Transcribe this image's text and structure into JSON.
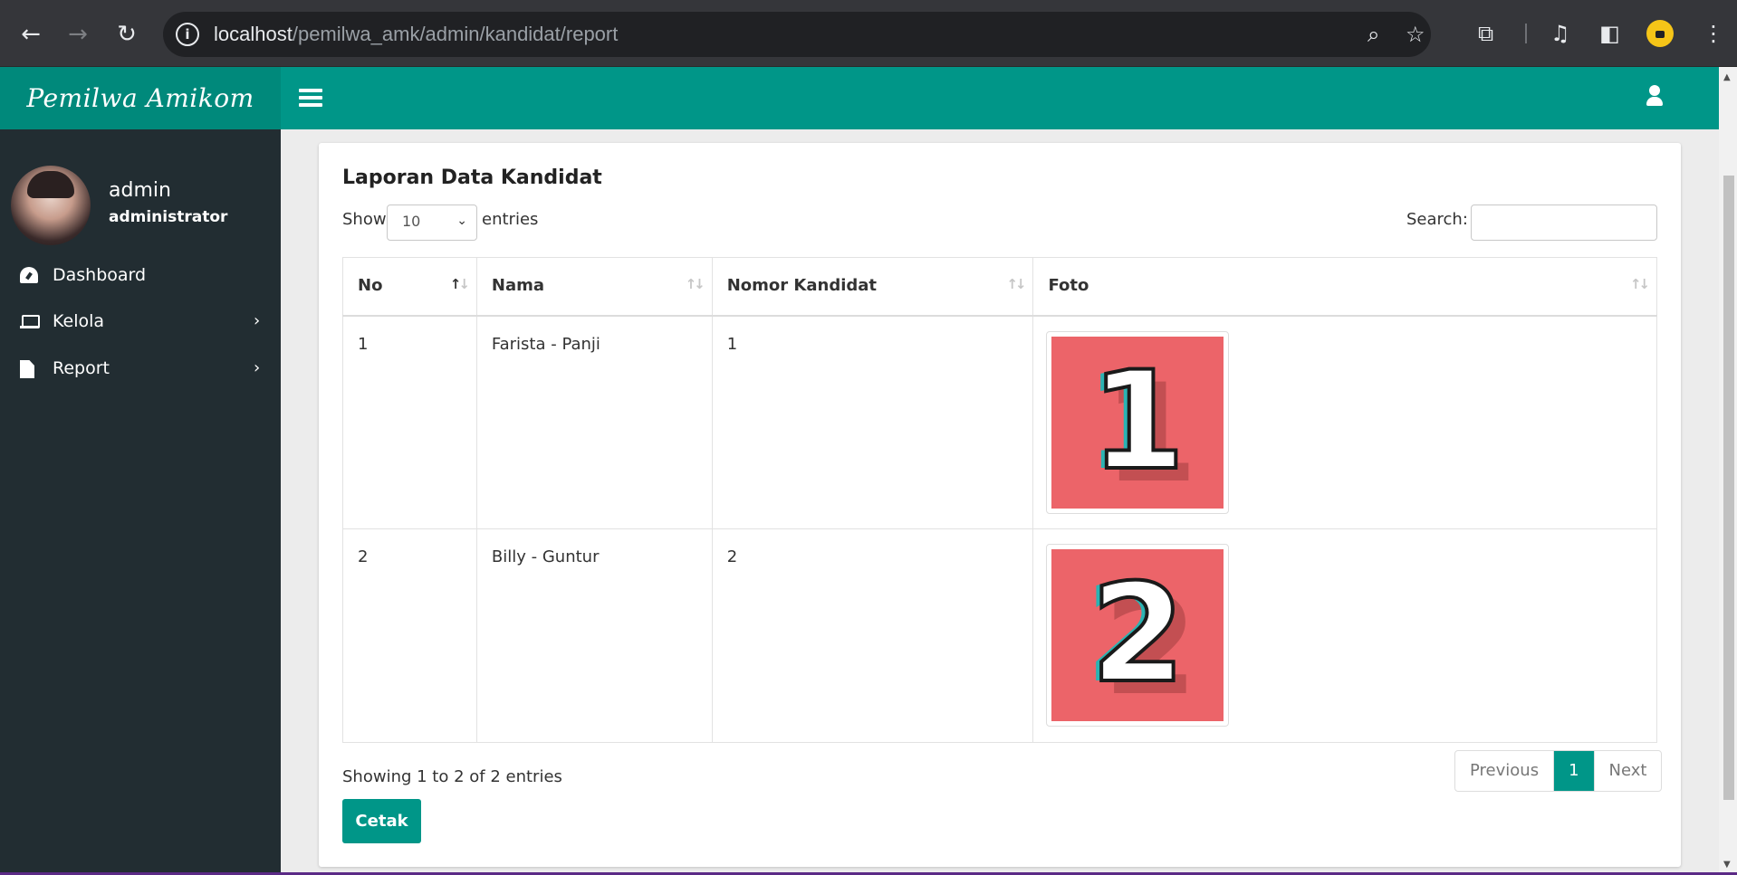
{
  "browser": {
    "url_host": "localhost",
    "url_path": "/pemilwa_amk/admin/kandidat/report",
    "info_glyph": "i"
  },
  "app": {
    "brand": "Pemilwa Amikom",
    "user": {
      "name": "admin",
      "role": "administrator"
    },
    "sidebar": {
      "items": [
        {
          "label": "Dashboard",
          "icon": "dashboard-icon"
        },
        {
          "label": "Kelola",
          "icon": "laptop-icon",
          "chevron": "›"
        },
        {
          "label": "Report",
          "icon": "file-icon",
          "chevron": "›"
        }
      ]
    },
    "accent_color": "#009688",
    "sidebar_color": "#222d32"
  },
  "card": {
    "title": "Laporan Data Kandidat",
    "show_label": "Show",
    "length_value": "10",
    "entries_label": "entries",
    "search_label": "Search:",
    "search_value": "",
    "columns": [
      "No",
      "Nama",
      "Nomor Kandidat",
      "Foto"
    ],
    "rows": [
      {
        "no": "1",
        "nama": "Farista - Panji",
        "nomor": "1",
        "foto_digit": "1"
      },
      {
        "no": "2",
        "nama": "Billy - Guntur",
        "nomor": "2",
        "foto_digit": "2"
      }
    ],
    "info": "Showing 1 to 2 of 2 entries",
    "pagination": {
      "previous": "Previous",
      "current": "1",
      "next": "Next"
    },
    "print_button": "Cetak"
  }
}
